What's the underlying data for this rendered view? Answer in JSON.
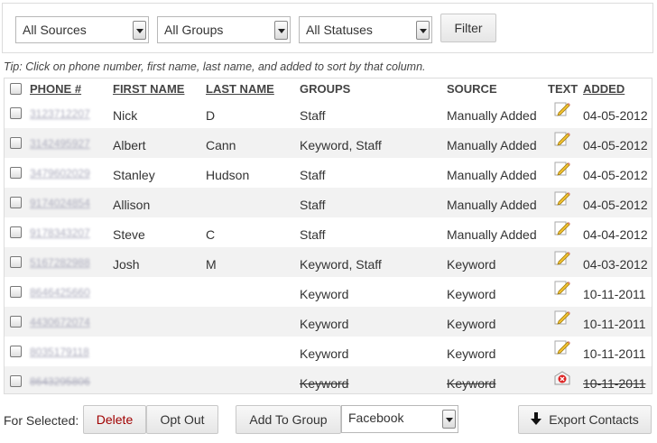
{
  "filters": {
    "sources_value": "All Sources",
    "groups_value": "All Groups",
    "statuses_value": "All Statuses",
    "filter_button": "Filter"
  },
  "tip": "Tip: Click on phone number, first name, last name, and added to sort by that column.",
  "table": {
    "headers": {
      "phone": "PHONE #",
      "first_name": "FIRST NAME",
      "last_name": "LAST NAME",
      "groups": "GROUPS",
      "source": "SOURCE",
      "text": "TEXT",
      "added": "ADDED"
    },
    "rows": [
      {
        "phone": "3123712207",
        "first": "Nick",
        "last": "D",
        "groups": "Staff",
        "source": "Manually Added",
        "text_icon": "pencil-icon",
        "added": "04-05-2012"
      },
      {
        "phone": "3142495927",
        "first": "Albert",
        "last": "Cann",
        "groups": "Keyword, Staff",
        "source": "Manually Added",
        "text_icon": "pencil-icon",
        "added": "04-05-2012"
      },
      {
        "phone": "3479602029",
        "first": "Stanley",
        "last": "Hudson",
        "groups": "Staff",
        "source": "Manually Added",
        "text_icon": "pencil-icon",
        "added": "04-05-2012"
      },
      {
        "phone": "9174024854",
        "first": "Allison",
        "last": "",
        "groups": "Staff",
        "source": "Manually Added",
        "text_icon": "pencil-icon",
        "added": "04-05-2012"
      },
      {
        "phone": "9178343207",
        "first": "Steve",
        "last": "C",
        "groups": "Staff",
        "source": "Manually Added",
        "text_icon": "pencil-icon",
        "added": "04-04-2012"
      },
      {
        "phone": "5167282988",
        "first": "Josh",
        "last": "M",
        "groups": "Keyword, Staff",
        "source": "Keyword",
        "text_icon": "pencil-icon",
        "added": "04-03-2012"
      },
      {
        "phone": "8646425660",
        "first": "",
        "last": "",
        "groups": "Keyword",
        "source": "Keyword",
        "text_icon": "pencil-icon",
        "added": "10-11-2011"
      },
      {
        "phone": "4430672074",
        "first": "",
        "last": "",
        "groups": "Keyword",
        "source": "Keyword",
        "text_icon": "pencil-icon",
        "added": "10-11-2011"
      },
      {
        "phone": "8035179118",
        "first": "",
        "last": "",
        "groups": "Keyword",
        "source": "Keyword",
        "text_icon": "pencil-icon",
        "added": "10-11-2011"
      },
      {
        "phone": "8643295806",
        "first": "",
        "last": "",
        "groups": "Keyword",
        "source": "Keyword",
        "text_icon": "opted-out-icon",
        "added": "10-11-2011",
        "deleted": true
      }
    ]
  },
  "bottom": {
    "for_selected": "For Selected:",
    "delete_button": "Delete",
    "opt_out_button": "Opt Out",
    "add_to_group_button": "Add To Group",
    "group_select_value": "Facebook",
    "export_button": "Export Contacts"
  },
  "colors": {
    "alt_row": "#f2f2f2",
    "delete_text": "#a00000",
    "phone_link": "#aab"
  }
}
